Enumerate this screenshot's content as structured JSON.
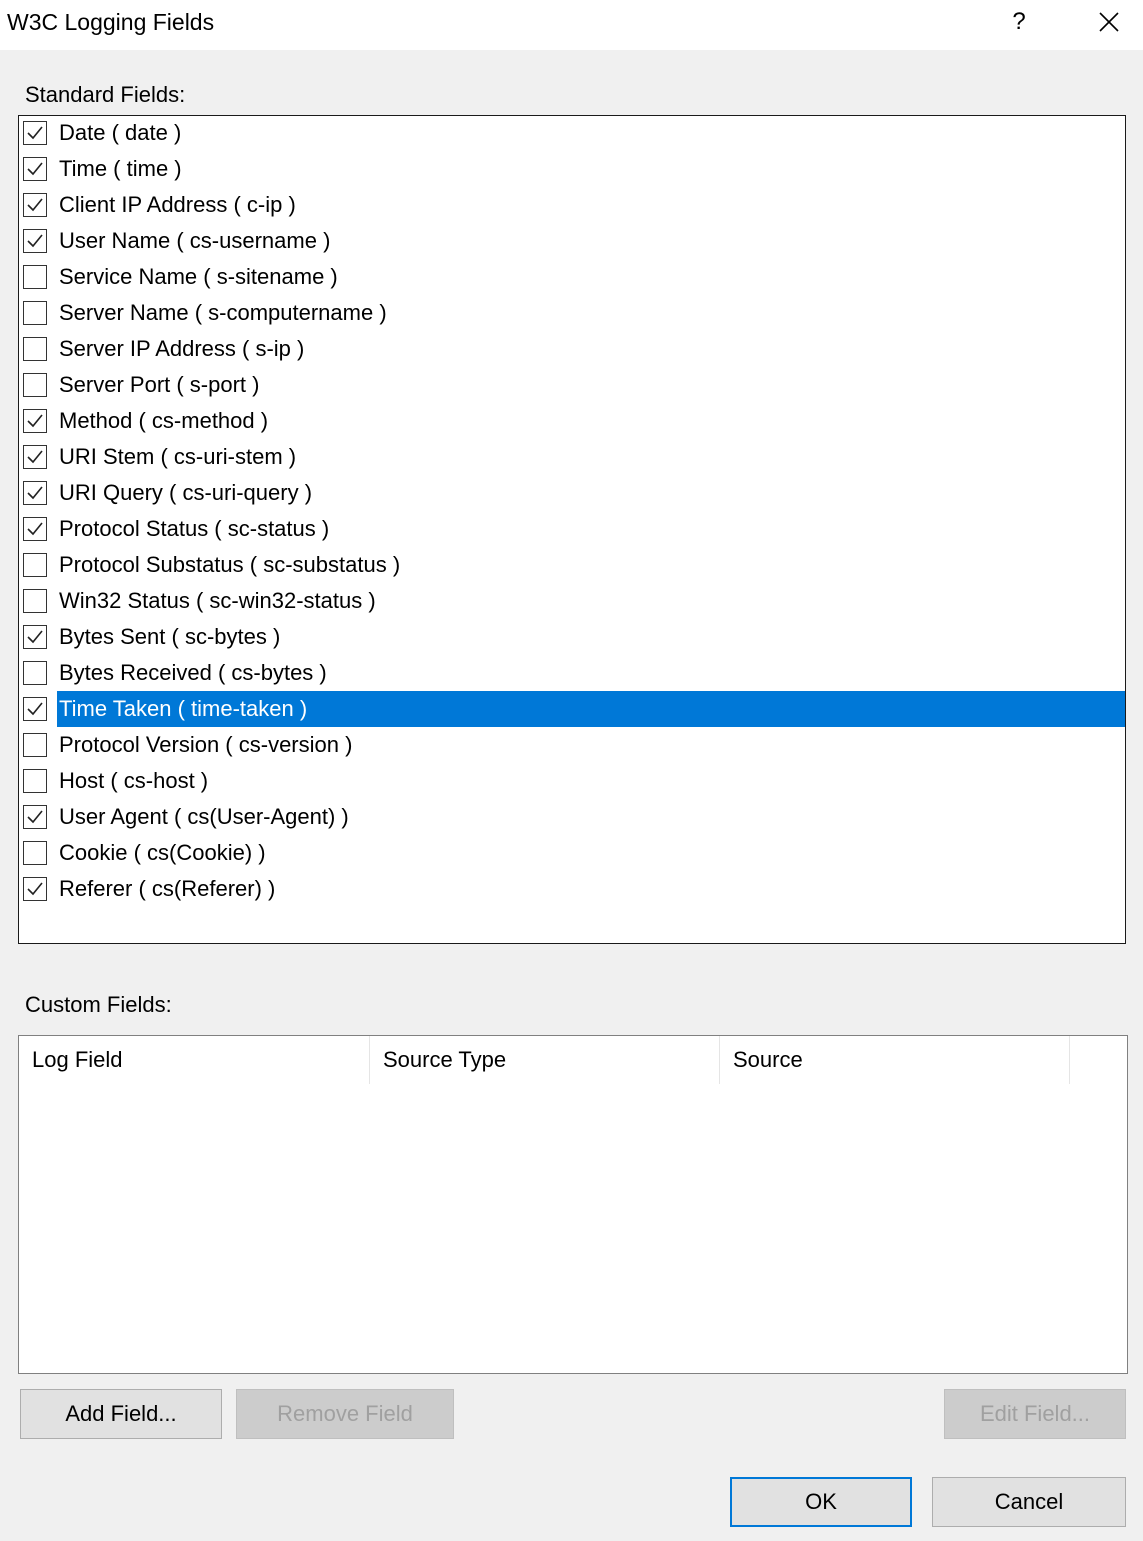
{
  "window": {
    "title": "W3C Logging Fields",
    "help_label": "?",
    "close_label": "✕"
  },
  "standard": {
    "label": "Standard Fields:",
    "items": [
      {
        "label": "Date ( date )",
        "checked": true
      },
      {
        "label": "Time ( time )",
        "checked": true
      },
      {
        "label": "Client IP Address ( c-ip )",
        "checked": true
      },
      {
        "label": "User Name ( cs-username )",
        "checked": true
      },
      {
        "label": "Service Name ( s-sitename )",
        "checked": false
      },
      {
        "label": "Server Name ( s-computername )",
        "checked": false
      },
      {
        "label": "Server IP Address ( s-ip )",
        "checked": false
      },
      {
        "label": "Server Port ( s-port )",
        "checked": false
      },
      {
        "label": "Method ( cs-method )",
        "checked": true
      },
      {
        "label": "URI Stem ( cs-uri-stem )",
        "checked": true
      },
      {
        "label": "URI Query ( cs-uri-query )",
        "checked": true
      },
      {
        "label": "Protocol Status ( sc-status )",
        "checked": true
      },
      {
        "label": "Protocol Substatus ( sc-substatus )",
        "checked": false
      },
      {
        "label": "Win32 Status ( sc-win32-status )",
        "checked": false
      },
      {
        "label": "Bytes Sent ( sc-bytes )",
        "checked": true
      },
      {
        "label": "Bytes Received ( cs-bytes )",
        "checked": false
      },
      {
        "label": "Time Taken ( time-taken )",
        "checked": true,
        "selected": true
      },
      {
        "label": "Protocol Version ( cs-version )",
        "checked": false
      },
      {
        "label": "Host ( cs-host )",
        "checked": false
      },
      {
        "label": "User Agent ( cs(User-Agent) )",
        "checked": true
      },
      {
        "label": "Cookie ( cs(Cookie) )",
        "checked": false
      },
      {
        "label": "Referer ( cs(Referer) )",
        "checked": true
      }
    ]
  },
  "custom": {
    "label": "Custom Fields:",
    "columns": [
      "Log Field",
      "Source Type",
      "Source"
    ]
  },
  "buttons": {
    "add_field": "Add Field...",
    "remove_field": "Remove Field",
    "edit_field": "Edit Field...",
    "ok": "OK",
    "cancel": "Cancel"
  },
  "colors": {
    "selection": "#0078d7",
    "dialog_bg": "#f0f0f0"
  }
}
